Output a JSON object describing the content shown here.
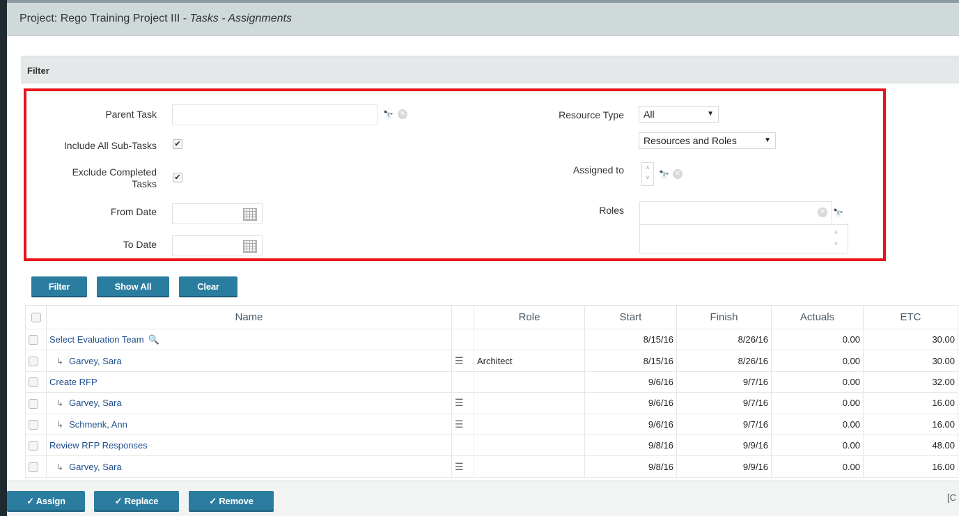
{
  "title": {
    "prefix": "Project: Rego Training Project III - ",
    "italic": "Tasks - Assignments"
  },
  "filter": {
    "header": "Filter",
    "parent_task_label": "Parent Task",
    "parent_task_value": "",
    "include_subtasks_label": "Include All Sub-Tasks",
    "include_subtasks_checked": "✔",
    "exclude_completed_label_1": "Exclude Completed",
    "exclude_completed_label_2": "Tasks",
    "exclude_completed_checked": "✔",
    "from_date_label": "From Date",
    "to_date_label": "To Date",
    "resource_type_label": "Resource Type",
    "resource_type_value": "All",
    "resource_mode_value": "Resources and Roles",
    "assigned_to_label": "Assigned to",
    "roles_label": "Roles"
  },
  "buttons": {
    "filter": "Filter",
    "show_all": "Show All",
    "clear": "Clear"
  },
  "table": {
    "headers": [
      "Name",
      "Role",
      "Start",
      "Finish",
      "Actuals",
      "ETC"
    ],
    "rows": [
      {
        "name": "Select Evaluation Team",
        "role": "",
        "start": "8/15/16",
        "finish": "8/26/16",
        "actuals": "0.00",
        "etc": "30.00"
      },
      {
        "name": "Garvey, Sara",
        "role": "Architect",
        "start": "8/15/16",
        "finish": "8/26/16",
        "actuals": "0.00",
        "etc": "30.00"
      },
      {
        "name": "Create RFP",
        "role": "",
        "start": "9/6/16",
        "finish": "9/7/16",
        "actuals": "0.00",
        "etc": "32.00"
      },
      {
        "name": "Garvey, Sara",
        "role": "",
        "start": "9/6/16",
        "finish": "9/7/16",
        "actuals": "0.00",
        "etc": "16.00"
      },
      {
        "name": "Schmenk, Ann",
        "role": "",
        "start": "9/6/16",
        "finish": "9/7/16",
        "actuals": "0.00",
        "etc": "16.00"
      },
      {
        "name": "Review RFP Responses",
        "role": "",
        "start": "9/8/16",
        "finish": "9/9/16",
        "actuals": "0.00",
        "etc": "48.00"
      },
      {
        "name": "Garvey, Sara",
        "role": "",
        "start": "9/8/16",
        "finish": "9/9/16",
        "actuals": "0.00",
        "etc": "16.00"
      }
    ]
  },
  "footer": {
    "assign": "✓ Assign",
    "replace": "✓ Replace",
    "remove": "✓ Remove",
    "corner": "[C"
  },
  "colors": {
    "accent": "#2b7da0",
    "highlight": "#e8141b",
    "title_bg": "#cfd9d9"
  }
}
